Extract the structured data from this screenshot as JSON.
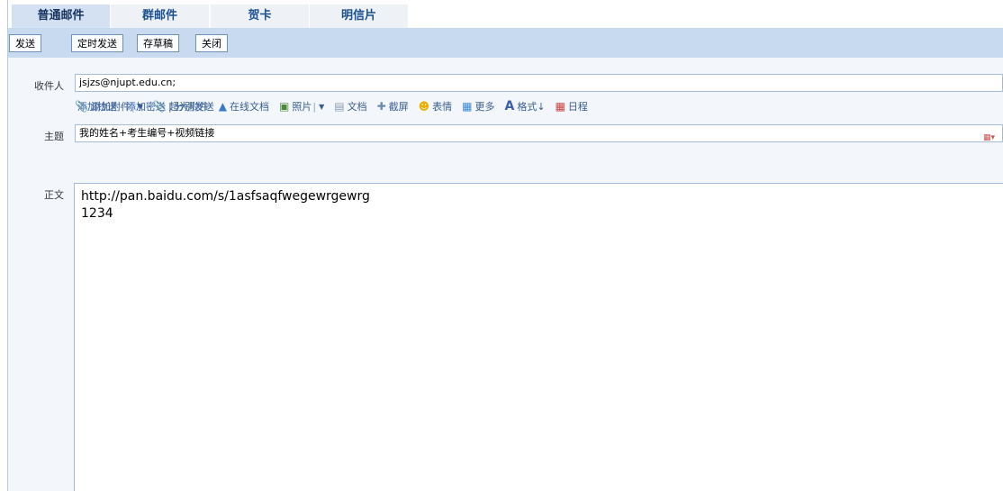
{
  "tabs": [
    {
      "label": "普通邮件"
    },
    {
      "label": "群邮件"
    },
    {
      "label": "贺卡"
    },
    {
      "label": "明信片"
    }
  ],
  "toolbar": {
    "send": "发送",
    "scheduled_send": "定时发送",
    "save_draft": "存草稿",
    "close": "关闭"
  },
  "recipient": {
    "label": "收件人",
    "value": "jsjzs@njupt.edu.cn;",
    "add_cc": "添加抄送",
    "dash": "-",
    "add_bcc": "添加密送",
    "pipe": "|",
    "separate_send": "分别发送"
  },
  "subject": {
    "label": "主题",
    "value": "我的姓名+考生编号+视频链接"
  },
  "attach_tools": {
    "attach": "添加附件",
    "big_attach": "超大附件",
    "online_doc": "在线文档",
    "photo": "照片",
    "document": "文档",
    "screenshot": "截屏",
    "emoji": "表情",
    "more": "更多",
    "format": "格式↓",
    "schedule": "日程"
  },
  "body": {
    "label": "正文",
    "line1": "http://pan.baidu.com/s/1asfsaqfwegewrgewrg",
    "line2": "1234"
  }
}
